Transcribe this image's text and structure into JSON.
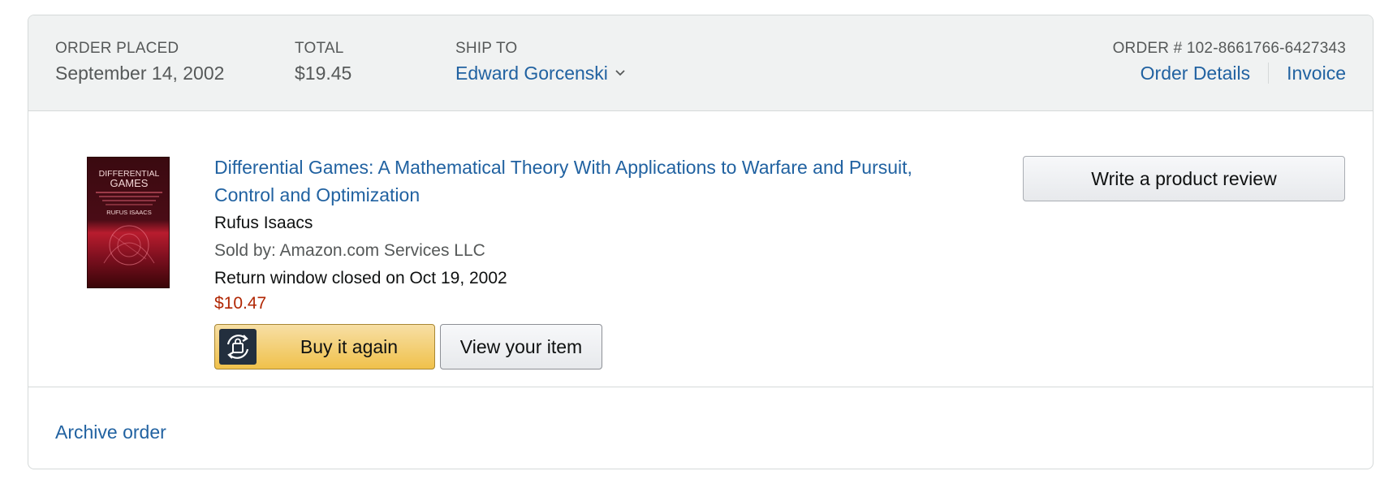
{
  "header": {
    "order_placed_label": "ORDER PLACED",
    "order_placed_value": "September 14, 2002",
    "total_label": "TOTAL",
    "total_value": "$19.45",
    "ship_to_label": "SHIP TO",
    "ship_to_value": "Edward Gorcenski",
    "order_number": "ORDER # 102-8661766-6427343",
    "order_details_link": "Order Details",
    "invoice_link": "Invoice"
  },
  "item": {
    "title": "Differential Games: A Mathematical Theory With Applications to Warfare and Pursuit, Control and Optimization",
    "author": "Rufus Isaacs",
    "sold_by": "Sold by: Amazon.com Services LLC",
    "return_window": "Return window closed on Oct 19, 2002",
    "price": "$10.47",
    "cover": {
      "title_line1": "DIFFERENTIAL",
      "title_line2": "GAMES",
      "author": "RUFUS ISAACS"
    }
  },
  "actions": {
    "buy_again_label": "Buy it again",
    "view_item_label": "View your item",
    "write_review_label": "Write a product review",
    "archive_label": "Archive order"
  },
  "icons": {
    "ship_to_dropdown": "chevron-down-icon",
    "buy_again": "buy-again-bag-icon"
  },
  "colors": {
    "link": "#2162a1",
    "price": "#b12704",
    "header_bg": "#f0f2f2",
    "buy_button": "#f0c14b"
  }
}
